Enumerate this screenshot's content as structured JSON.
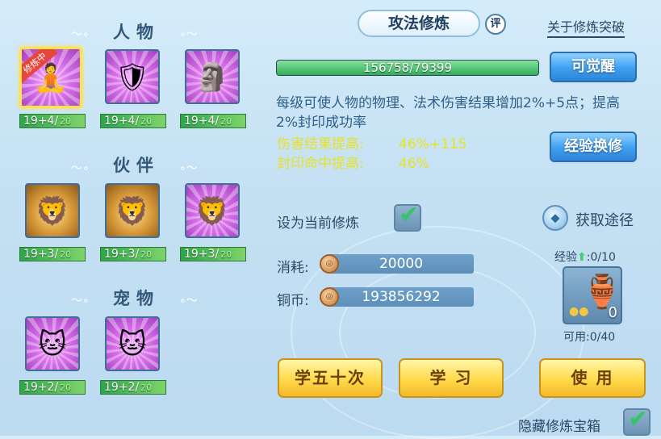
{
  "left": {
    "sections": [
      {
        "title": "人物",
        "slots": [
          {
            "icon": "monk-figure-icon",
            "badge": "修炼中",
            "level": "19+4/",
            "max": "20",
            "selected": true
          },
          {
            "icon": "armor-figure-icon",
            "level": "19+4/",
            "max": "20"
          },
          {
            "icon": "idol-figure-icon",
            "level": "19+4/",
            "max": "20"
          }
        ]
      },
      {
        "title": "伙伴",
        "slots": [
          {
            "icon": "lion-sword-icon",
            "level": "19+3/",
            "max": "20"
          },
          {
            "icon": "lion-shield-icon",
            "level": "19+3/",
            "max": "20"
          },
          {
            "icon": "lion-glove-icon",
            "level": "19+3/",
            "max": "20"
          }
        ]
      },
      {
        "title": "宠物",
        "slots": [
          {
            "icon": "cat-sword-icon",
            "level": "19+2/",
            "max": "20"
          },
          {
            "icon": "cat-shield-icon",
            "level": "19+2/",
            "max": "20"
          }
        ]
      }
    ]
  },
  "header": {
    "title": "攻法修炼",
    "eval_label": "评",
    "about_link": "关于修炼突破"
  },
  "progress": {
    "text": "156758/79399",
    "fill_fraction": 1.0
  },
  "buttons": {
    "awaken": "可觉醒",
    "exchange": "经验换修",
    "learn_fifty": "学五十次",
    "learn": "学 习",
    "use": "使 用"
  },
  "description": "每级可使人物的物理、法术伤害结果增加2%+5点；提高2%封印成功率",
  "stats": [
    {
      "label": "伤害结果提高:",
      "value": "46%+115"
    },
    {
      "label": "封印命中提高:",
      "value": "46%"
    }
  ],
  "set_current": {
    "label": "设为当前修炼",
    "checked": true
  },
  "obtain": {
    "label": "获取途径"
  },
  "resources": {
    "cost_label": "消耗:",
    "cost_value": "20000",
    "coin_label": "铜币:",
    "coin_value": "193856292"
  },
  "item": {
    "exp_label": "经验",
    "exp_value": ":0/10",
    "count": "0",
    "usable": "可用:0/40"
  },
  "hide_chest": {
    "label": "隐藏修炼宝箱",
    "checked": true
  },
  "colors": {
    "accent_blue": "#3d9ff0",
    "stat_yellow": "#e8e128",
    "desc_blue": "#2d5f8a",
    "progress_green": "#2fae58"
  }
}
